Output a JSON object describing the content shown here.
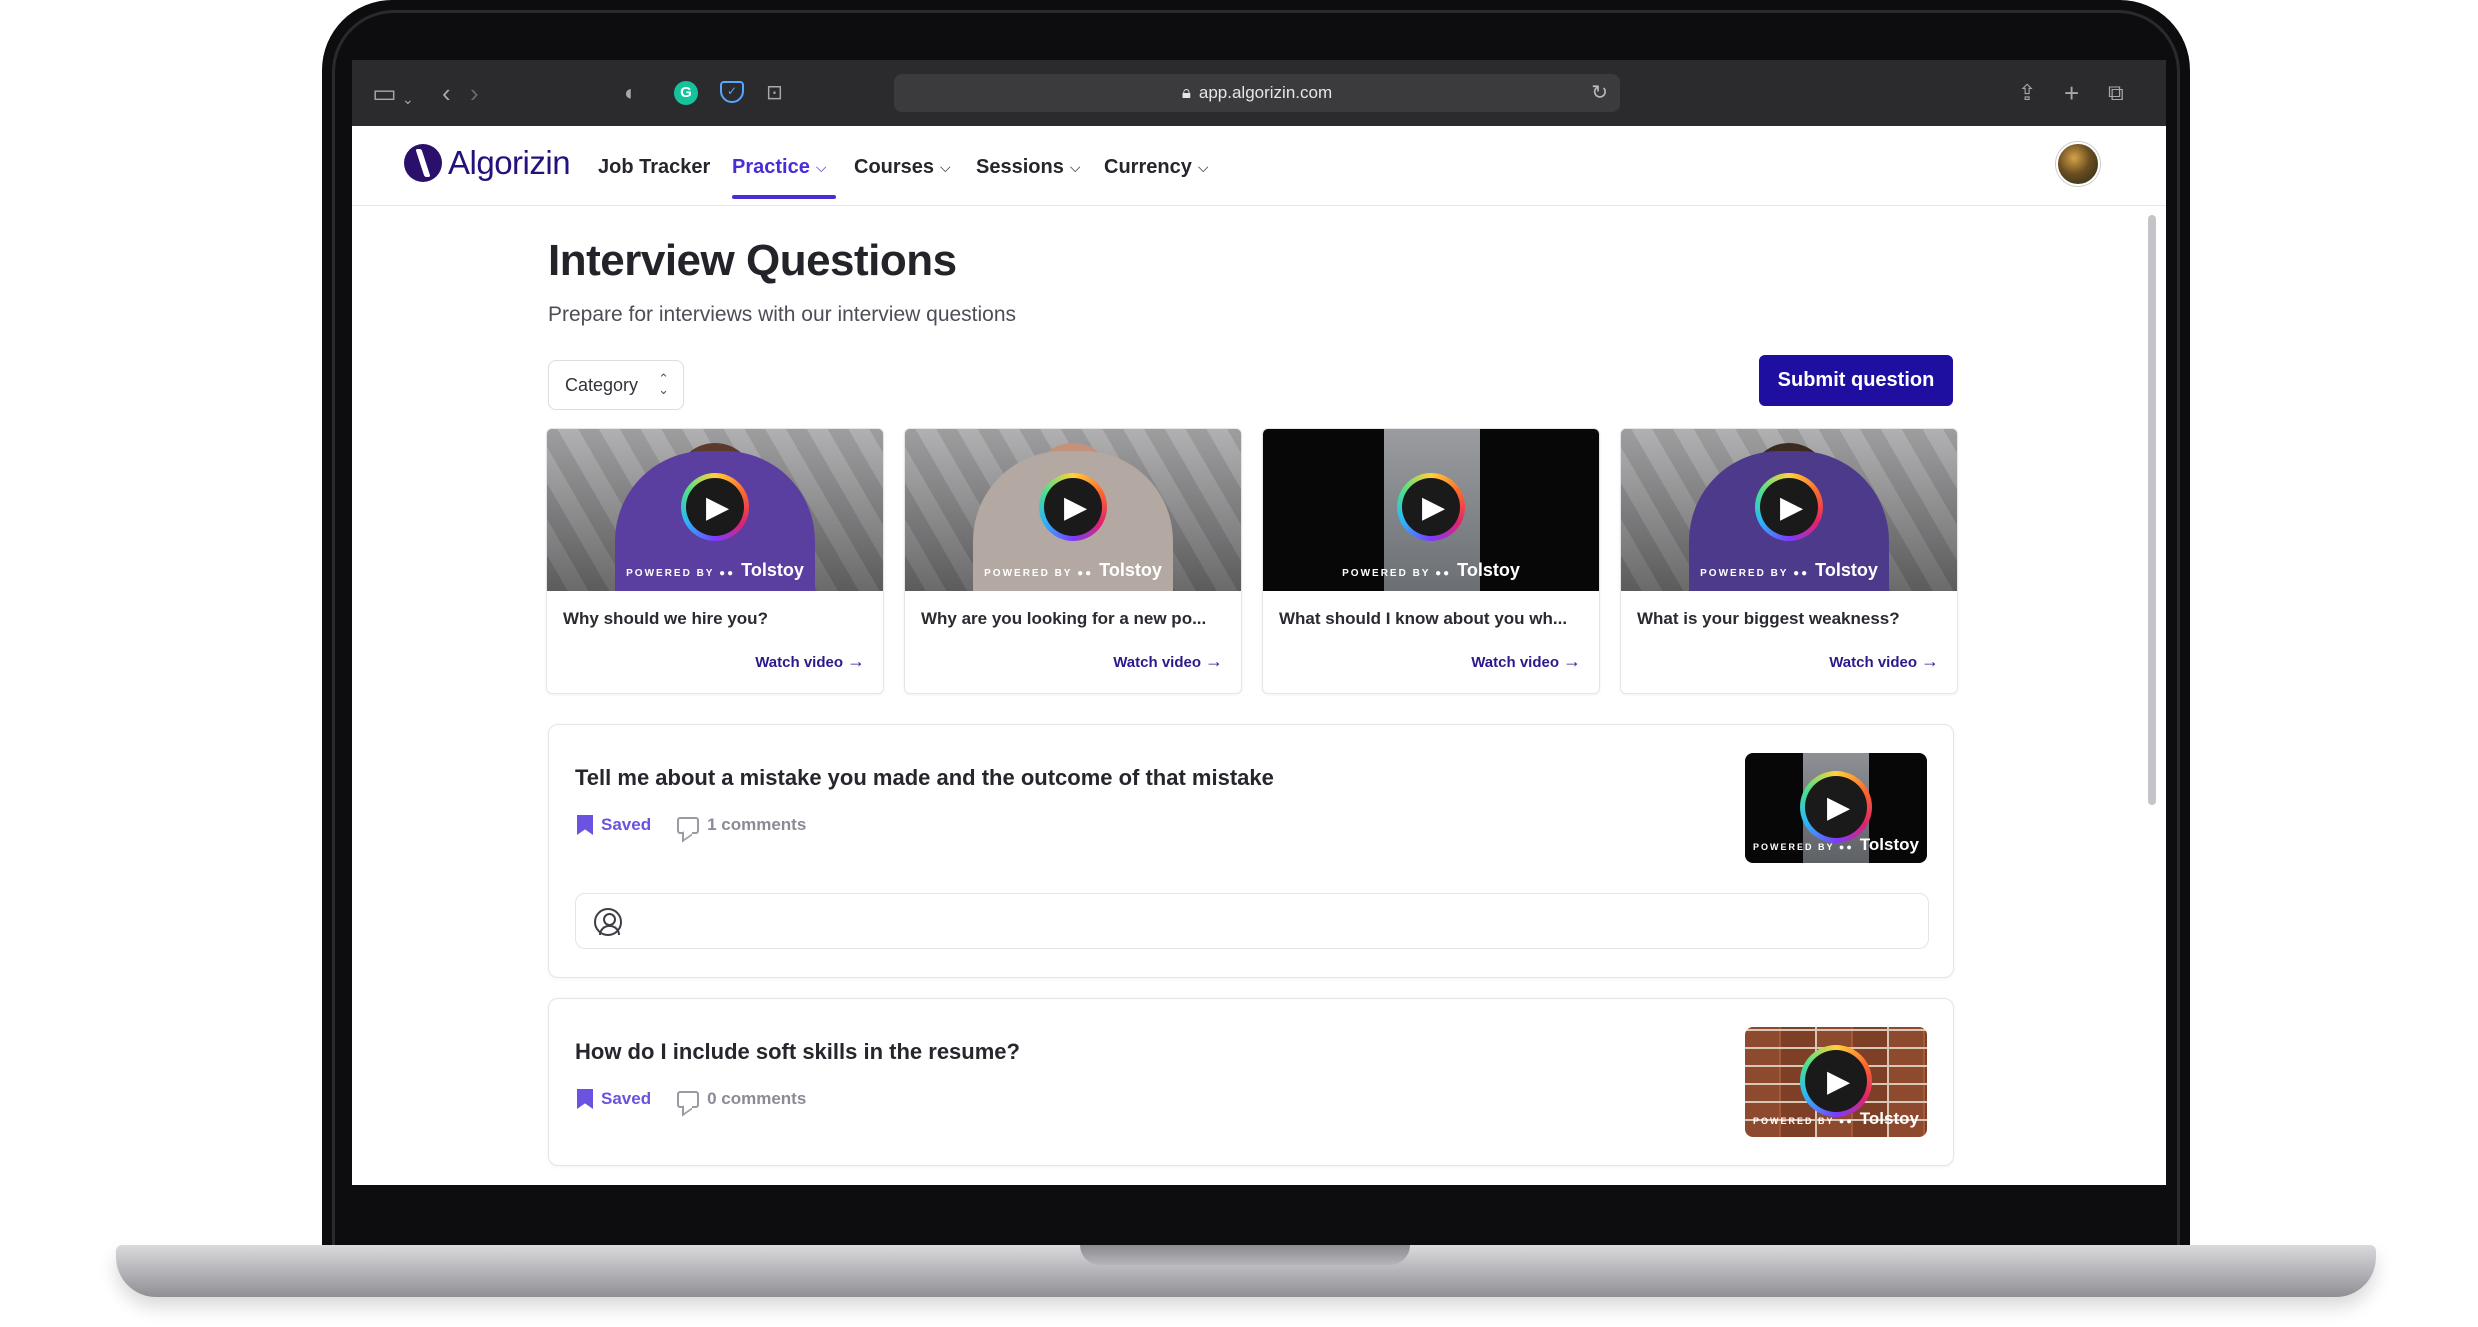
{
  "browser": {
    "url": "app.algorizin.com",
    "extensions": [
      "shield-icon",
      "grammarly-icon",
      "pocket-icon",
      "magnifier-icon"
    ],
    "grammarly_letter": "G"
  },
  "nav": {
    "logo_text": "Algorizin",
    "items": [
      {
        "label": "Job Tracker",
        "dropdown": false,
        "active": false
      },
      {
        "label": "Practice",
        "dropdown": true,
        "active": true
      },
      {
        "label": "Courses",
        "dropdown": true,
        "active": false
      },
      {
        "label": "Sessions",
        "dropdown": true,
        "active": false
      },
      {
        "label": "Currency",
        "dropdown": true,
        "active": false
      }
    ],
    "accent_color": "#4a2bd8"
  },
  "page": {
    "title": "Interview Questions",
    "subtitle": "Prepare for interviews with our interview questions",
    "category_select": "Category",
    "submit_label": "Submit question",
    "submit_color": "#1e0fa0"
  },
  "video_cards": [
    {
      "question": "Why should we hire you?",
      "watch": "Watch video"
    },
    {
      "question": "Why are you looking for a new po...",
      "watch": "Watch video"
    },
    {
      "question": "What should I know about you wh...",
      "watch": "Watch video"
    },
    {
      "question": "What is your biggest weakness?",
      "watch": "Watch video"
    }
  ],
  "video_badge": {
    "powered_by": "POWERED BY",
    "brand": "Tolstoy"
  },
  "questions": [
    {
      "title": "Tell me about a mistake you made and the outcome of that mistake",
      "saved_label": "Saved",
      "comments_label": "1 comments"
    },
    {
      "title": "How do I include soft skills in the resume?",
      "saved_label": "Saved",
      "comments_label": "0 comments"
    }
  ]
}
